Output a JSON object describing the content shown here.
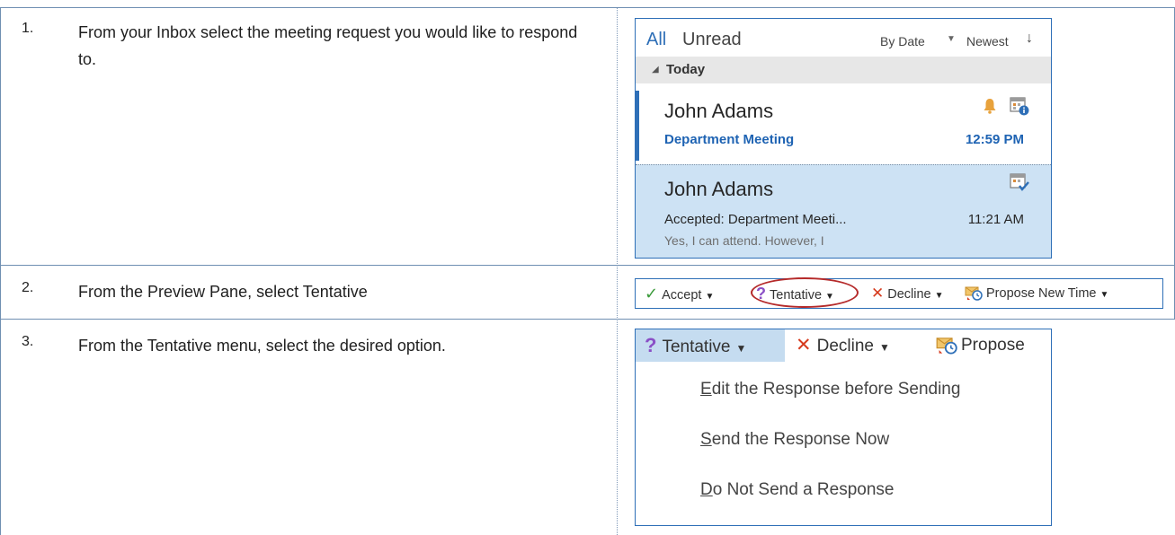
{
  "steps": [
    {
      "number": "1.",
      "text": "From your Inbox select the meeting request you would like to respond to."
    },
    {
      "number": "2.",
      "text": "From the Preview Pane, select Tentative"
    },
    {
      "number": "3.",
      "text": "From the Tentative menu, select the desired option."
    }
  ],
  "inbox": {
    "filter_all": "All",
    "filter_unread": "Unread",
    "sort_by": "By Date",
    "sort_order": "Newest",
    "sort_order_arrow": "↓",
    "group_label": "Today",
    "messages": [
      {
        "sender": "John Adams",
        "subject": "Department Meeting",
        "time": "12:59 PM",
        "preview": ""
      },
      {
        "sender": "John Adams",
        "subject": "Accepted: Department Meeti...",
        "time": "11:21 AM",
        "preview": "Yes, I can attend. However, I"
      }
    ]
  },
  "toolbar": {
    "accept": "Accept",
    "tentative": "Tentative",
    "decline": "Decline",
    "propose": "Propose New Time"
  },
  "tentative_menu": {
    "tentative": "Tentative",
    "decline": "Decline",
    "propose": "Propose",
    "options": [
      {
        "accel": "E",
        "rest": "dit the Response before Sending"
      },
      {
        "accel": "S",
        "rest": "end the Response Now"
      },
      {
        "accel": "D",
        "rest": "o Not Send a Response"
      }
    ]
  },
  "colors": {
    "accent_blue": "#2e6fb7",
    "selected_row": "#cde2f4",
    "highlight_circle": "#b52a2a",
    "accept_green": "#3a9a3a",
    "tentative_purple": "#8a4fc6",
    "decline_red": "#d63b1e"
  },
  "icons": [
    "bell-icon",
    "calendar-info-icon",
    "calendar-check-icon",
    "checkmark-icon",
    "question-mark-icon",
    "x-icon",
    "propose-time-icon",
    "dropdown-arrow-icon"
  ]
}
